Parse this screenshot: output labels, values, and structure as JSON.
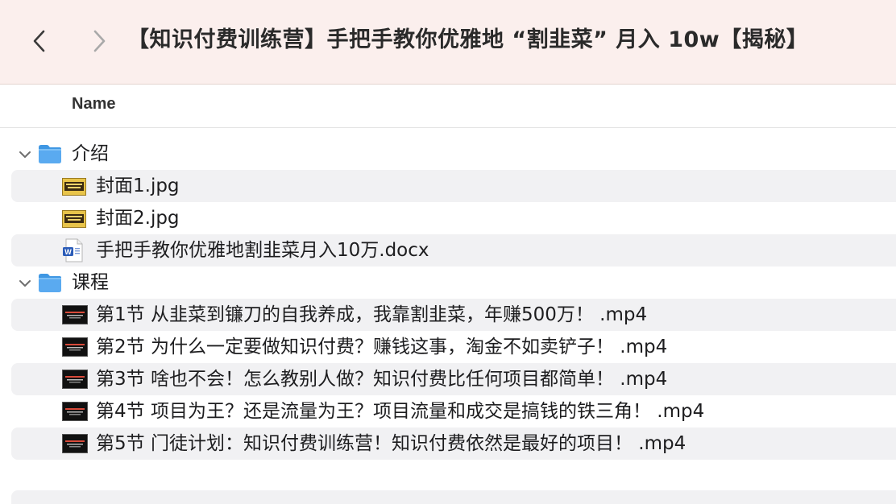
{
  "window": {
    "title": "【知识付费训练营】手把手教你优雅地 “割韭菜” 月入 10w【揭秘】"
  },
  "toolbar": {
    "back_icon": "chevron-left-icon",
    "forward_icon": "chevron-right-icon"
  },
  "columns": {
    "name": "Name"
  },
  "colors": {
    "toolbar_bg": "#fbefed",
    "folder_blue": "#5aaaf0",
    "stripe": "#f1f1f3"
  },
  "files": [
    {
      "type": "folder",
      "level": 0,
      "expanded": true,
      "name": "介绍",
      "icon": "folder-icon"
    },
    {
      "type": "jpg",
      "level": 1,
      "name": "封面1.jpg",
      "icon": "image-thumbnail-icon"
    },
    {
      "type": "jpg",
      "level": 1,
      "name": "封面2.jpg",
      "icon": "image-thumbnail-icon"
    },
    {
      "type": "docx",
      "level": 1,
      "name": "手把手教你优雅地割韭菜月入10万.docx",
      "icon": "word-document-icon"
    },
    {
      "type": "folder",
      "level": 0,
      "expanded": true,
      "name": "课程",
      "icon": "folder-icon"
    },
    {
      "type": "mp4",
      "level": 1,
      "name": "第1节 从韭菜到镰刀的自我养成，我靠割韭菜，年赚500万！ .mp4",
      "icon": "video-thumbnail-icon"
    },
    {
      "type": "mp4",
      "level": 1,
      "name": "第2节 为什么一定要做知识付费？赚钱这事，淘金不如卖铲子！ .mp4",
      "icon": "video-thumbnail-icon"
    },
    {
      "type": "mp4",
      "level": 1,
      "name": "第3节 啥也不会！怎么教别人做？知识付费比任何项目都简单！ .mp4",
      "icon": "video-thumbnail-icon"
    },
    {
      "type": "mp4",
      "level": 1,
      "name": "第4节 项目为王？还是流量为王？项目流量和成交是搞钱的铁三角！ .mp4",
      "icon": "video-thumbnail-icon"
    },
    {
      "type": "mp4",
      "level": 1,
      "name": "第5节 门徒计划：知识付费训练营！知识付费依然是最好的项目！ .mp4",
      "icon": "video-thumbnail-icon"
    }
  ]
}
